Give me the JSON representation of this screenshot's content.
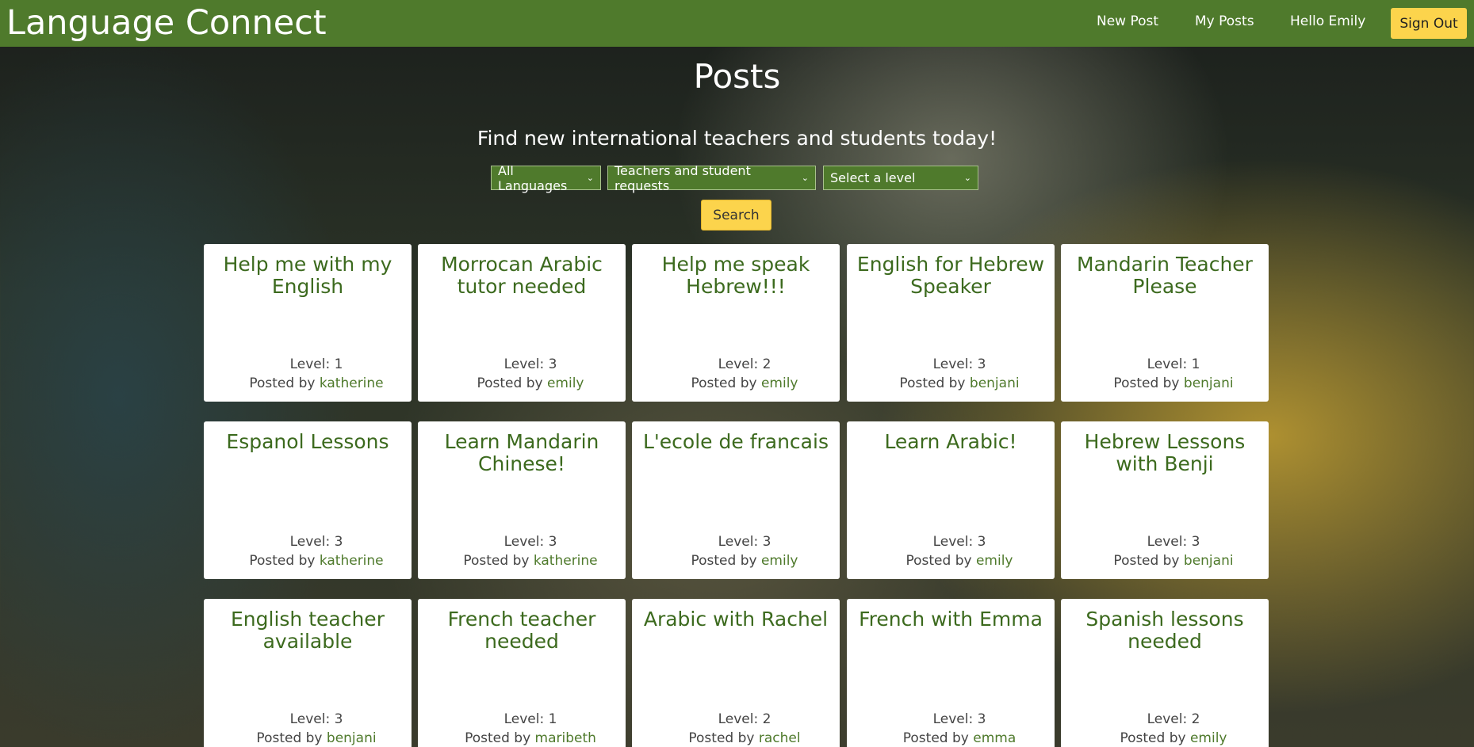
{
  "navbar": {
    "brand": "Language Connect",
    "links": [
      "New Post",
      "My Posts",
      "Hello Emily"
    ],
    "signout_label": "Sign Out",
    "bg_color": "#4f7a2c"
  },
  "page": {
    "title": "Posts",
    "subtitle": "Find new international teachers and students today!"
  },
  "filters": {
    "language": "All Languages",
    "type": "Teachers and student requests",
    "level": "Select a level",
    "search_label": "Search"
  },
  "posted_by_label": "Posted by",
  "level_label": "Level:",
  "posts": [
    {
      "title": "Help me with my English",
      "level": "1",
      "author": "katherine"
    },
    {
      "title": "Morrocan Arabic tutor needed",
      "level": "3",
      "author": "emily"
    },
    {
      "title": "Help me speak Hebrew!!!",
      "level": "2",
      "author": "emily"
    },
    {
      "title": "English for Hebrew Speaker",
      "level": "3",
      "author": "benjani"
    },
    {
      "title": "Mandarin Teacher Please",
      "level": "1",
      "author": "benjani"
    },
    {
      "title": "Espanol Lessons",
      "level": "3",
      "author": "katherine"
    },
    {
      "title": "Learn Mandarin Chinese!",
      "level": "3",
      "author": "katherine"
    },
    {
      "title": "L'ecole de francais",
      "level": "3",
      "author": "emily"
    },
    {
      "title": "Learn Arabic!",
      "level": "3",
      "author": "emily"
    },
    {
      "title": "Hebrew Lessons with Benji",
      "level": "3",
      "author": "benjani"
    },
    {
      "title": "English teacher available",
      "level": "3",
      "author": "benjani"
    },
    {
      "title": "French teacher needed",
      "level": "1",
      "author": "maribeth"
    },
    {
      "title": "Arabic with Rachel",
      "level": "2",
      "author": "rachel"
    },
    {
      "title": "French with Emma",
      "level": "3",
      "author": "emma"
    },
    {
      "title": "Spanish lessons needed",
      "level": "2",
      "author": "emily"
    }
  ]
}
